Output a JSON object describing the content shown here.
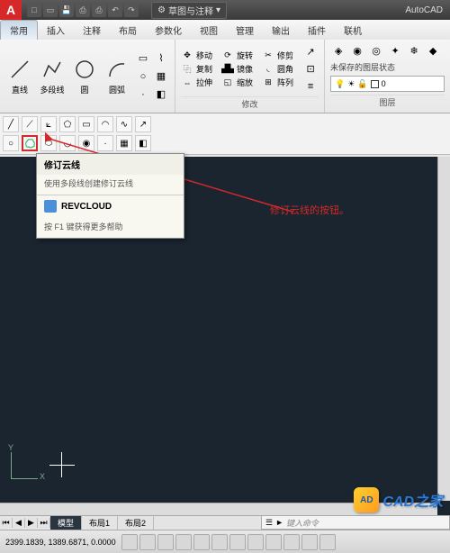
{
  "app": {
    "name": "AutoCAD",
    "logo": "A"
  },
  "workspace": {
    "label": "草图与注释"
  },
  "tabs": [
    "常用",
    "插入",
    "注释",
    "布局",
    "参数化",
    "视图",
    "管理",
    "输出",
    "插件",
    "联机"
  ],
  "active_tab": 0,
  "draw_panel": {
    "line": "直线",
    "pline": "多段线",
    "circle": "圆",
    "arc": "圆弧"
  },
  "modify_panel": {
    "label": "修改",
    "rows": [
      [
        "移动",
        "旋转",
        "修剪"
      ],
      [
        "复制",
        "镜像",
        "圆角"
      ],
      [
        "拉伸",
        "缩放",
        "阵列"
      ]
    ]
  },
  "layer_panel": {
    "label": "图层",
    "unsaved": "未保存的图层状态",
    "current": "0"
  },
  "tooltip": {
    "title": "修订云线",
    "desc": "使用多段线创建修订云线",
    "cmd": "REVCLOUD",
    "help": "按 F1 键获得更多帮助"
  },
  "annotation": "修订云线的按钮。",
  "bottom_tabs": {
    "model": "模型",
    "layout1": "布局1",
    "layout2": "布局2"
  },
  "cmdline": {
    "prompt": "►",
    "placeholder": "键入命令"
  },
  "status": {
    "coords": "2399.1839, 1389.6871, 0.0000"
  },
  "watermark": {
    "icon": "AD",
    "text": "CAD之家"
  }
}
